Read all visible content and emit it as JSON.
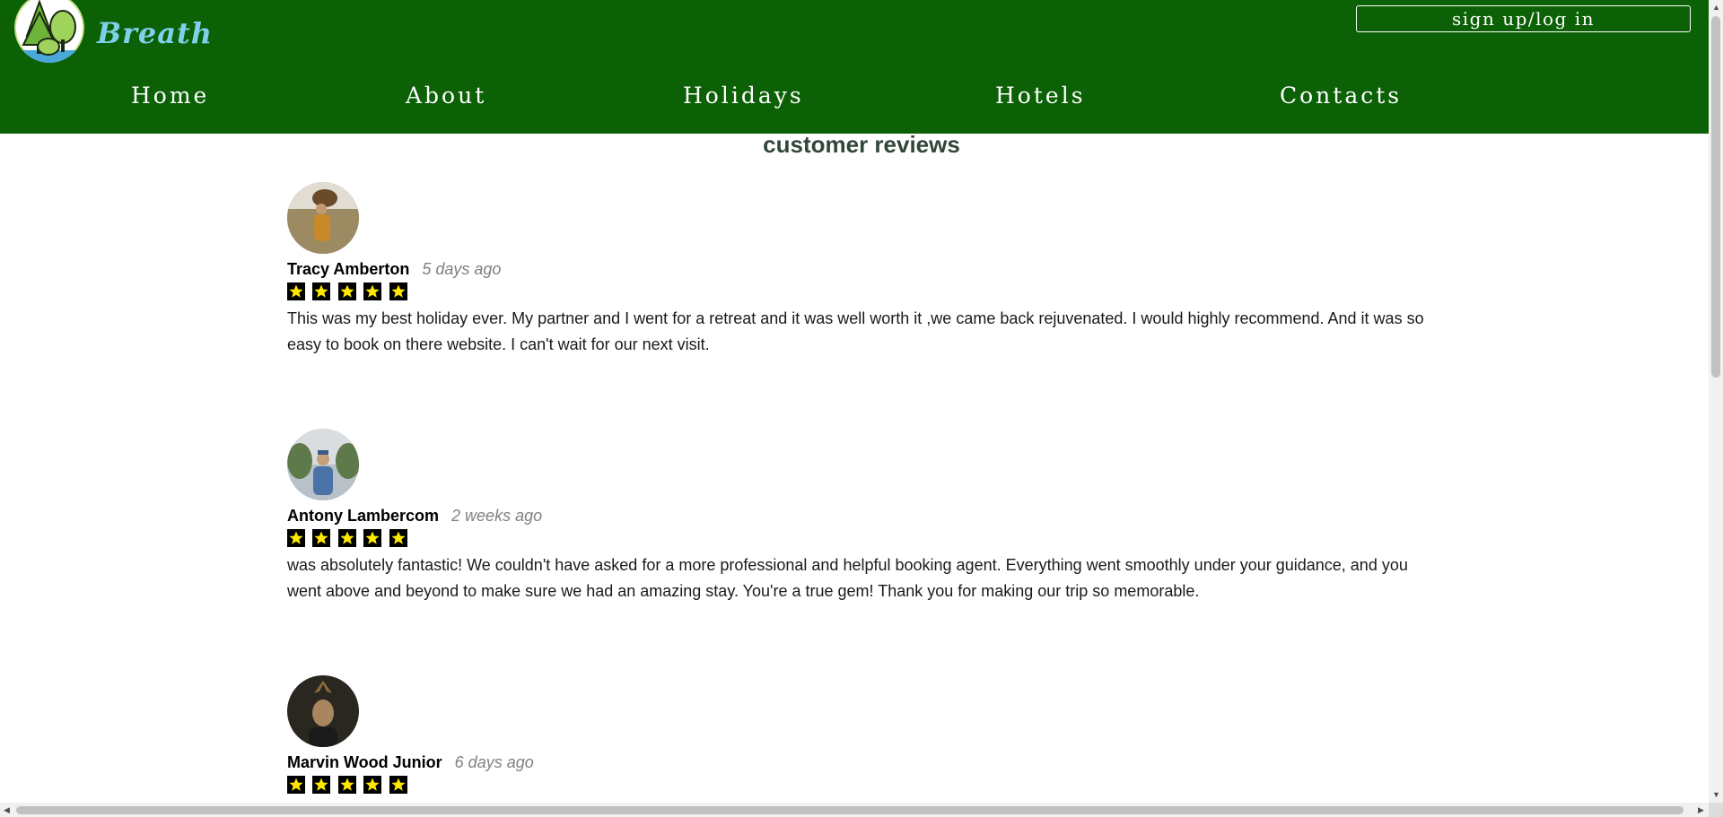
{
  "header": {
    "brand": "Breath",
    "auth_button": "sign up/log in",
    "nav": [
      "Home",
      "About",
      "Holidays",
      "Hotels",
      "Contacts"
    ]
  },
  "main": {
    "section_title": "customer reviews",
    "reviews": [
      {
        "name": "Tracy Amberton",
        "time": "5 days ago",
        "rating": 5,
        "text": "This was my best holiday ever. My partner and I went for a retreat and it was well worth it ,we came back rejuvenated. I would highly recommend. And it was so easy to book on there website. I can't wait for our next visit."
      },
      {
        "name": "Antony Lambercom",
        "time": "2 weeks ago",
        "rating": 5,
        "text": "was absolutely fantastic! We couldn't have asked for a more professional and helpful booking agent. Everything went smoothly under your guidance, and you went above and beyond to make sure we had an amazing stay. You're a true gem! Thank you for making our trip so memorable."
      },
      {
        "name": "Marvin Wood Junior",
        "time": "6 days ago",
        "rating": 5,
        "text": ""
      }
    ]
  },
  "colors": {
    "header_bg": "#0c6006",
    "brand": "#7fd0ea",
    "star_fill": "#ffe800",
    "star_bg": "#000000"
  }
}
